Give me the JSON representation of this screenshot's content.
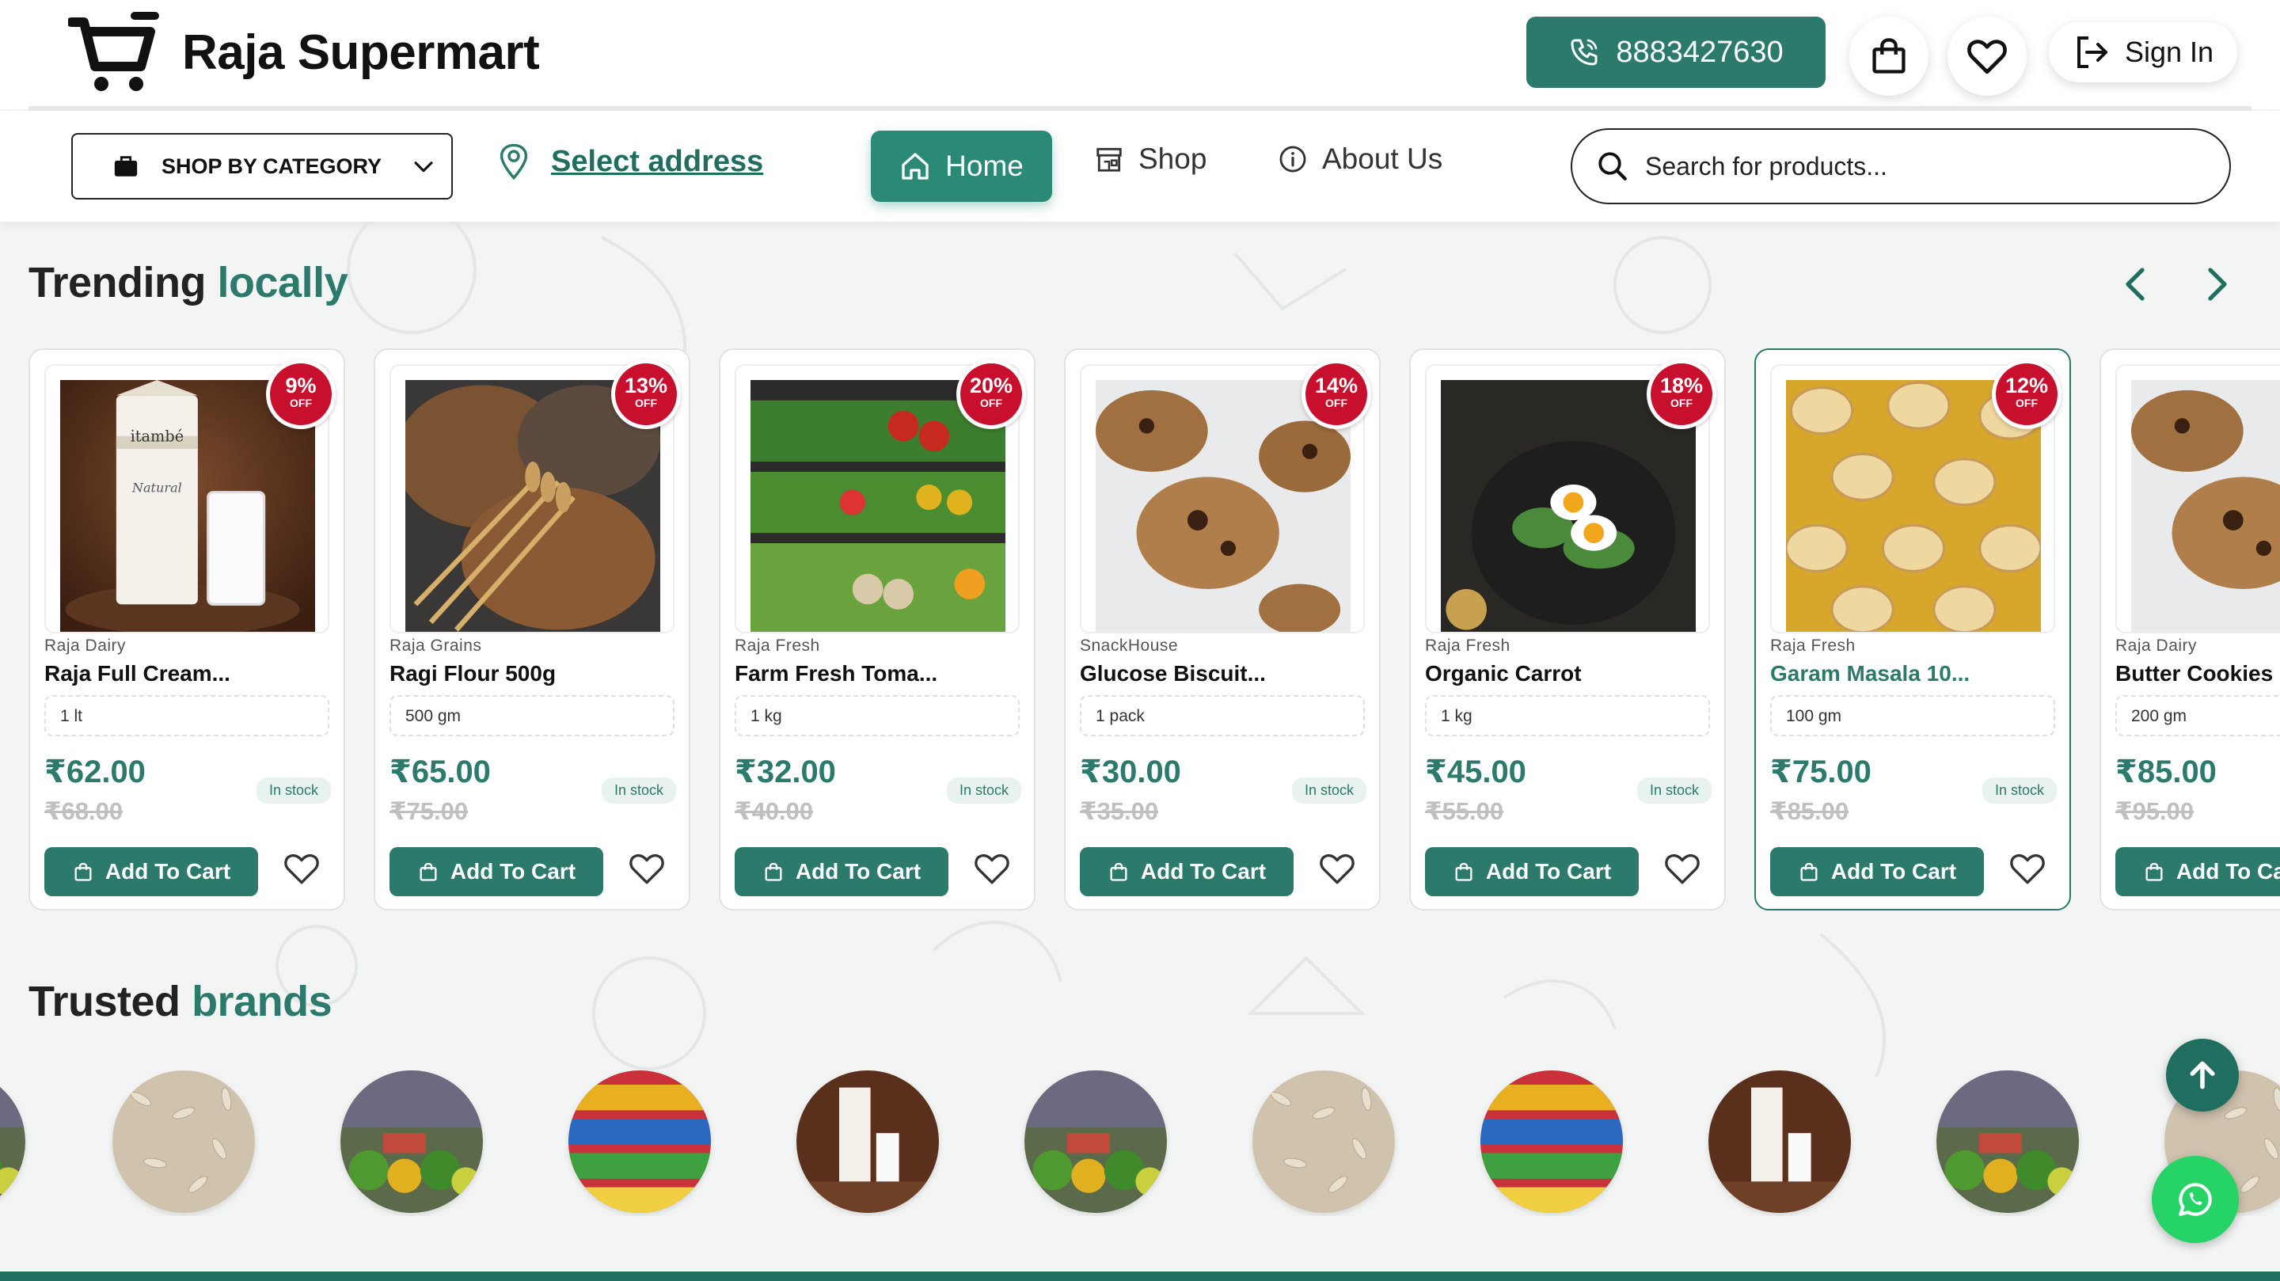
{
  "header": {
    "brand_name": "Raja Supermart",
    "phone": "8883427630",
    "sign_in_label": "Sign In",
    "cart_icon": "shopping-bag-icon",
    "wishlist_icon": "heart-icon"
  },
  "nav": {
    "category_label": "SHOP BY CATEGORY",
    "address_label": "Select address",
    "home_label": "Home",
    "shop_label": "Shop",
    "about_label": "About Us",
    "search_placeholder": "Search for products..."
  },
  "trending": {
    "title_main": "Trending",
    "title_accent": "locally",
    "add_to_cart_label": "Add To Cart",
    "stock_label": "In stock",
    "off_label": "OFF",
    "products": [
      {
        "brand": "Raja Dairy",
        "name": "Raja Full Cream...",
        "qty": "1 lt",
        "price": "₹62.00",
        "mrp": "₹68.00",
        "discount": "9%",
        "image": "milk"
      },
      {
        "brand": "Raja Grains",
        "name": "Ragi Flour 500g",
        "qty": "500 gm",
        "price": "₹65.00",
        "mrp": "₹75.00",
        "discount": "13%",
        "image": "bread"
      },
      {
        "brand": "Raja Fresh",
        "name": "Farm Fresh Toma...",
        "qty": "1 kg",
        "price": "₹32.00",
        "mrp": "₹40.00",
        "discount": "20%",
        "image": "vegetables"
      },
      {
        "brand": "SnackHouse",
        "name": "Glucose Biscuit...",
        "qty": "1 pack",
        "price": "₹30.00",
        "mrp": "₹35.00",
        "discount": "14%",
        "image": "cookies"
      },
      {
        "brand": "Raja Fresh",
        "name": "Organic Carrot",
        "qty": "1 kg",
        "price": "₹45.00",
        "mrp": "₹55.00",
        "discount": "18%",
        "image": "egg-plate"
      },
      {
        "brand": "Raja Fresh",
        "name": "Garam Masala 10...",
        "qty": "100 gm",
        "price": "₹75.00",
        "mrp": "₹85.00",
        "discount": "12%",
        "image": "chips"
      },
      {
        "brand": "Raja Dairy",
        "name": "Butter Cookies ...",
        "qty": "200 gm",
        "price": "₹85.00",
        "mrp": "₹95.00",
        "discount": "",
        "image": "cookies"
      }
    ]
  },
  "brands_section": {
    "title_main": "Trusted",
    "title_accent": "brands",
    "logos": [
      "market",
      "rice",
      "market",
      "snacks",
      "milk",
      "market",
      "rice",
      "snacks",
      "milk",
      "market",
      "rice"
    ]
  },
  "colors": {
    "primary": "#2b7a6b",
    "discount_badge": "#c8102e",
    "whatsapp": "#25d366"
  }
}
